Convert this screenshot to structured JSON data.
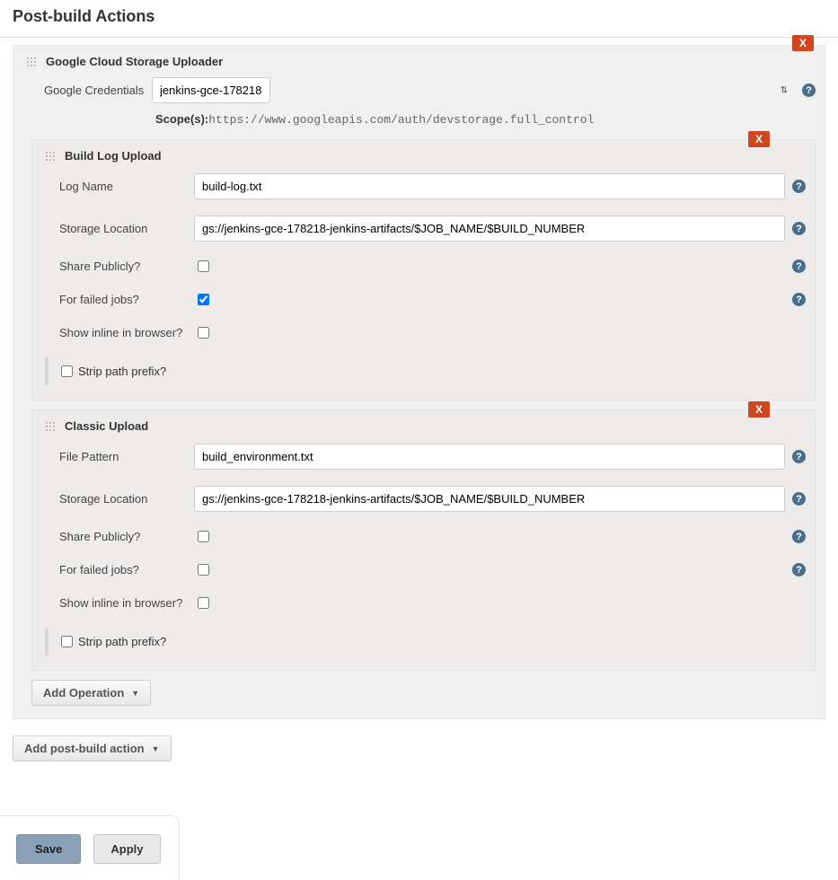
{
  "page": {
    "title": "Post-build Actions"
  },
  "uploader": {
    "title": "Google Cloud Storage Uploader",
    "delete_label": "X",
    "credentials_label": "Google Credentials",
    "credentials_value": "jenkins-gce-178218",
    "scope_label": "Scope(s):",
    "scope_url": "https://www.googleapis.com/auth/devstorage.full_control"
  },
  "build_log": {
    "title": "Build Log Upload",
    "delete_label": "X",
    "log_name_label": "Log Name",
    "log_name_value": "build-log.txt",
    "storage_label": "Storage Location",
    "storage_value": "gs://jenkins-gce-178218-jenkins-artifacts/$JOB_NAME/$BUILD_NUMBER",
    "share_label": "Share Publicly?",
    "share_checked": false,
    "failed_label": "For failed jobs?",
    "failed_checked": true,
    "inline_label": "Show inline in browser?",
    "inline_checked": false,
    "strip_label": "Strip path prefix?",
    "strip_checked": false
  },
  "classic": {
    "title": "Classic Upload",
    "delete_label": "X",
    "pattern_label": "File Pattern",
    "pattern_value": "build_environment.txt",
    "storage_label": "Storage Location",
    "storage_value": "gs://jenkins-gce-178218-jenkins-artifacts/$JOB_NAME/$BUILD_NUMBER",
    "share_label": "Share Publicly?",
    "share_checked": false,
    "failed_label": "For failed jobs?",
    "failed_checked": false,
    "inline_label": "Show inline in browser?",
    "inline_checked": false,
    "strip_label": "Strip path prefix?",
    "strip_checked": false
  },
  "buttons": {
    "add_operation": "Add Operation",
    "add_post_build": "Add post-build action",
    "save": "Save",
    "apply": "Apply"
  },
  "help_glyph": "?"
}
